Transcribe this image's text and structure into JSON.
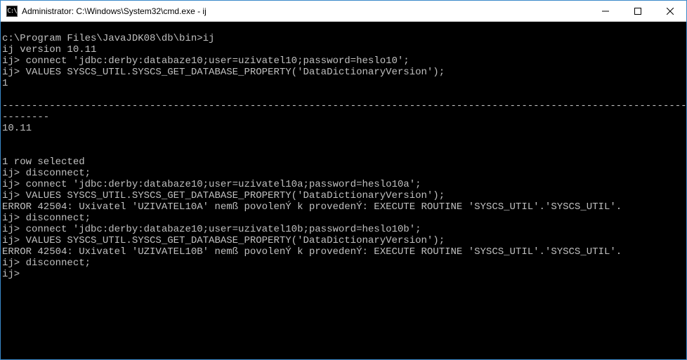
{
  "window": {
    "title": "Administrator: C:\\Windows\\System32\\cmd.exe - ij",
    "icon_text": "C:\\"
  },
  "terminal": {
    "lines": [
      "",
      "c:\\Program Files\\JavaJDK08\\db\\bin>ij",
      "ij version 10.11",
      "ij> connect 'jdbc:derby:databaze10;user=uzivatel10;password=heslo10';",
      "ij> VALUES SYSCS_UTIL.SYSCS_GET_DATABASE_PROPERTY('DataDictionaryVersion');",
      "1",
      "",
      "--------------------------------------------------------------------------------------------------------------------------------",
      "--------",
      "10.11",
      "",
      "",
      "1 row selected",
      "ij> disconnect;",
      "ij> connect 'jdbc:derby:databaze10;user=uzivatel10a;password=heslo10a';",
      "ij> VALUES SYSCS_UTIL.SYSCS_GET_DATABASE_PROPERTY('DataDictionaryVersion');",
      "ERROR 42504: Uxivatel 'UZIVATEL10A' nemß povolenÝ k provedenÝ: EXECUTE ROUTINE 'SYSCS_UTIL'.'SYSCS_UTIL'.",
      "ij> disconnect;",
      "ij> connect 'jdbc:derby:databaze10;user=uzivatel10b;password=heslo10b';",
      "ij> VALUES SYSCS_UTIL.SYSCS_GET_DATABASE_PROPERTY('DataDictionaryVersion');",
      "ERROR 42504: Uxivatel 'UZIVATEL10B' nemß povolenÝ k provedenÝ: EXECUTE ROUTINE 'SYSCS_UTIL'.'SYSCS_UTIL'.",
      "ij> disconnect;",
      "ij>"
    ]
  }
}
